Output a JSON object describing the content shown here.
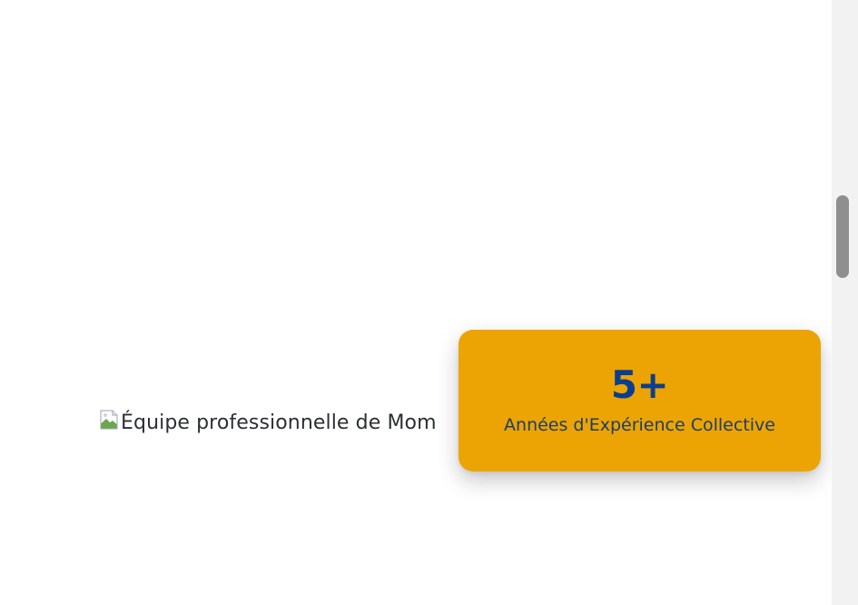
{
  "image": {
    "alt": "Équipe professionnelle de Mom",
    "icon": "broken-image-icon"
  },
  "stat": {
    "value": "5+",
    "label": "Années d'Expérience Collective",
    "background_color": "#eba404",
    "value_color": "#0b3e8e"
  },
  "scrollbar": {
    "icon": "vertical-scrollbar"
  }
}
